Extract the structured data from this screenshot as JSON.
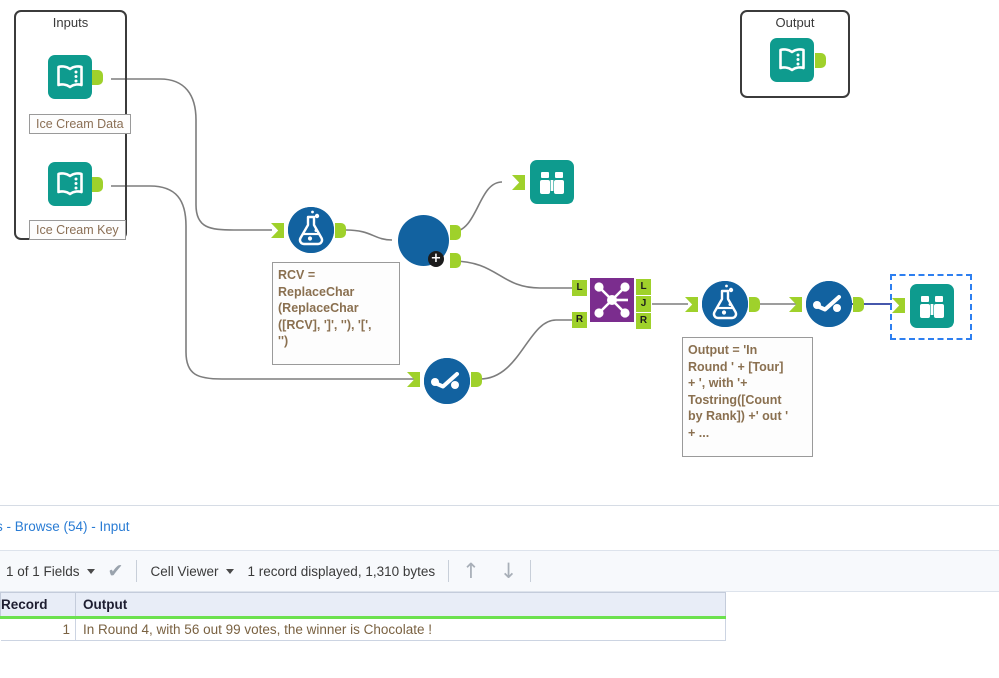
{
  "canvas": {
    "containers": [
      {
        "name": "inputs-container",
        "title": "Inputs"
      },
      {
        "name": "output-container",
        "title": "Output"
      }
    ],
    "tool_labels": [
      {
        "text": "Ice Cream Data"
      },
      {
        "text": "Ice Cream Key"
      }
    ],
    "notes": [
      {
        "text": "RCV =\nReplaceChar\n(ReplaceChar\n([RCV], ']', ''), '[',\n'')"
      },
      {
        "text": "Output = 'In\nRound ' + [Tour]\n+ ', with '+\nTostring([Count\nby Rank]) +' out '\n+ ..."
      }
    ],
    "anchors": {
      "join_in_left": "L",
      "join_in_right": "R",
      "join_out_left": "L",
      "join_out_join": "J",
      "join_out_right": "R"
    },
    "icons": {
      "input_data": "book-input-icon",
      "formula": "flask-formula-icon",
      "browse": "binoculars-browse-icon",
      "sort": "sort-icon",
      "join": "join-icon",
      "union": "union-circle-icon",
      "plus_badge": "+"
    },
    "colors": {
      "teal_tool": "#0e9b8e",
      "blue_tool": "#1262a0",
      "purple_tool": "#7b2d8e",
      "anchor_green": "#9fd12b",
      "selection_blue": "#2d7ff0",
      "wire_gray": "#7d7d7d"
    }
  },
  "results": {
    "title": "s - Browse (54) - Input",
    "toolbar": {
      "fields_selector": "1 of 1 Fields",
      "check_icon": "✔",
      "view_selector": "Cell Viewer",
      "record_status": "1 record displayed, 1,310 bytes",
      "up_icon": "↑",
      "down_icon": "↓"
    },
    "table": {
      "columns": [
        "Record",
        "Output"
      ],
      "rows": [
        {
          "record": "1",
          "output": "In Round 4, with 56 out 99 votes, the winner is Chocolate !"
        }
      ]
    }
  }
}
